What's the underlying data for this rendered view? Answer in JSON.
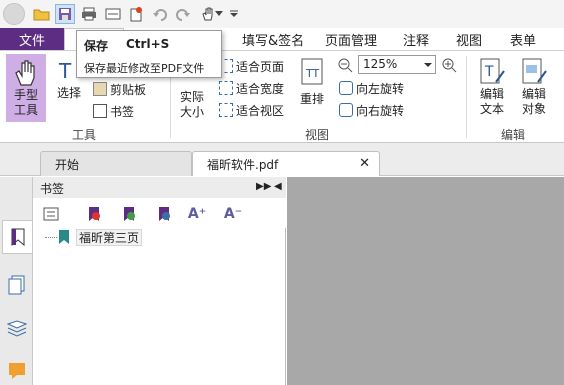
{
  "quick_access": {
    "icons": [
      "app-menu-icon",
      "open-folder-icon",
      "save-icon",
      "print-icon",
      "scan-icon",
      "new-icon",
      "undo-icon",
      "redo-icon",
      "hand-tool-icon",
      "dropdown-icon",
      "customize-icon"
    ]
  },
  "tabs": {
    "file": "文件",
    "fill_sign": "填写&签名",
    "page_manage": "页面管理",
    "comment": "注释",
    "view": "视图",
    "form": "表单"
  },
  "tooltip": {
    "title": "保存",
    "shortcut": "Ctrl+S",
    "description": "保存最近修改至PDF文件"
  },
  "ribbon": {
    "tools_group": {
      "label": "工具",
      "hand_tool": [
        "手型",
        "工具"
      ],
      "select": "选择",
      "clipboard": "剪贴板",
      "bookmark": "书签"
    },
    "view_group": {
      "label": "视图",
      "actual_size": [
        "实际",
        "大小"
      ],
      "fit_page": "适合页面",
      "fit_width": "适合宽度",
      "fit_visible": "适合视区",
      "reflow": "重排",
      "zoom_value": "125%",
      "rotate_left": "向左旋转",
      "rotate_right": "向右旋转"
    },
    "edit_group": {
      "label": "编辑",
      "edit_text": [
        "编辑",
        "文本"
      ],
      "edit_object": [
        "编辑",
        "对象"
      ]
    }
  },
  "doc_tabs": {
    "start": "开始",
    "file": "福昕软件.pdf"
  },
  "bookmark_panel": {
    "title": "书签",
    "items": [
      "福昕第三页"
    ]
  },
  "colors": {
    "file_tab": "#5c2d82",
    "hand_tool_highlight": "#cfaee6",
    "doc_background": "#a8a8a8"
  }
}
